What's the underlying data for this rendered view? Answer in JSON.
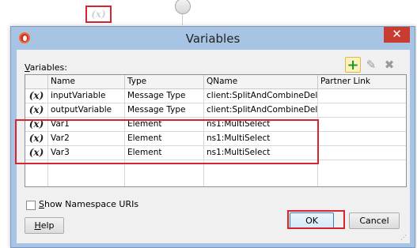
{
  "background": {
    "variable_icon": "(x)"
  },
  "window": {
    "title": "Variables",
    "close_symbol": "✕"
  },
  "dialog": {
    "variables_label_prefix": "",
    "variables_label_mnemonic": "V",
    "variables_label_rest": "ariables:",
    "toolbar": {
      "add_icon": "+",
      "edit_icon": "✎",
      "delete_icon": "✖"
    },
    "table": {
      "headers": [
        "",
        "Name",
        "Type",
        "QName",
        "Partner Link"
      ],
      "rows": [
        {
          "icon": "(x)",
          "name": "inputVariable",
          "type": "Message Type",
          "qname": "client:SplitAndCombineDeli...",
          "partner_link": ""
        },
        {
          "icon": "(x)",
          "name": "outputVariable",
          "type": "Message Type",
          "qname": "client:SplitAndCombineDeli...",
          "partner_link": ""
        },
        {
          "icon": "(x)",
          "name": "Var1",
          "type": "Element",
          "qname": "ns1:MultiSelect",
          "partner_link": ""
        },
        {
          "icon": "(x)",
          "name": "Var2",
          "type": "Element",
          "qname": "ns1:MultiSelect",
          "partner_link": ""
        },
        {
          "icon": "(x)",
          "name": "Var3",
          "type": "Element",
          "qname": "ns1:MultiSelect",
          "partner_link": ""
        }
      ]
    },
    "show_namespace": {
      "checked": false,
      "label_mnemonic": "S",
      "label_rest": "how Namespace URIs"
    },
    "buttons": {
      "help_mnemonic": "H",
      "help_rest": "elp",
      "ok": "OK",
      "cancel": "Cancel"
    },
    "accent_color": "#d9242e"
  }
}
